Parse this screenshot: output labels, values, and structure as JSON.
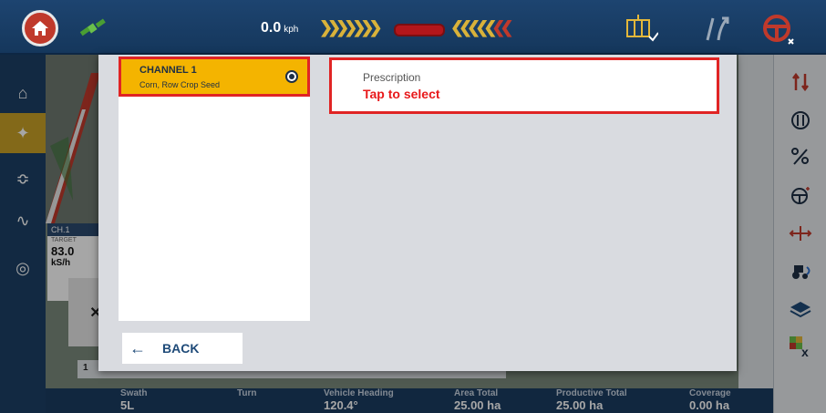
{
  "topbar": {
    "speed_value": "0.0",
    "speed_unit": "kph"
  },
  "map": {
    "channel_tag": "CH.1",
    "target_label": "TARGET",
    "target_value": "83.0",
    "target_unit": "kS/h",
    "row_number": "1"
  },
  "stats": [
    {
      "title": "Swath",
      "value": "5L"
    },
    {
      "title": "Turn",
      "value": ""
    },
    {
      "title": "Vehicle Heading",
      "value": "120.4°"
    },
    {
      "title": "Area Total",
      "value": "25.00 ha"
    },
    {
      "title": "Productive Total",
      "value": "25.00 ha"
    },
    {
      "title": "Coverage",
      "value": "0.00 ha"
    }
  ],
  "modal": {
    "channel": {
      "name": "CHANNEL 1",
      "subtitle": "Corn, Row Crop Seed"
    },
    "prescription": {
      "label": "Prescription",
      "value": "Tap to select"
    },
    "back_label": "BACK"
  },
  "colors": {
    "accent_yellow": "#f4b400",
    "highlight_red": "#e02424",
    "topbar_blue": "#1d4470"
  }
}
